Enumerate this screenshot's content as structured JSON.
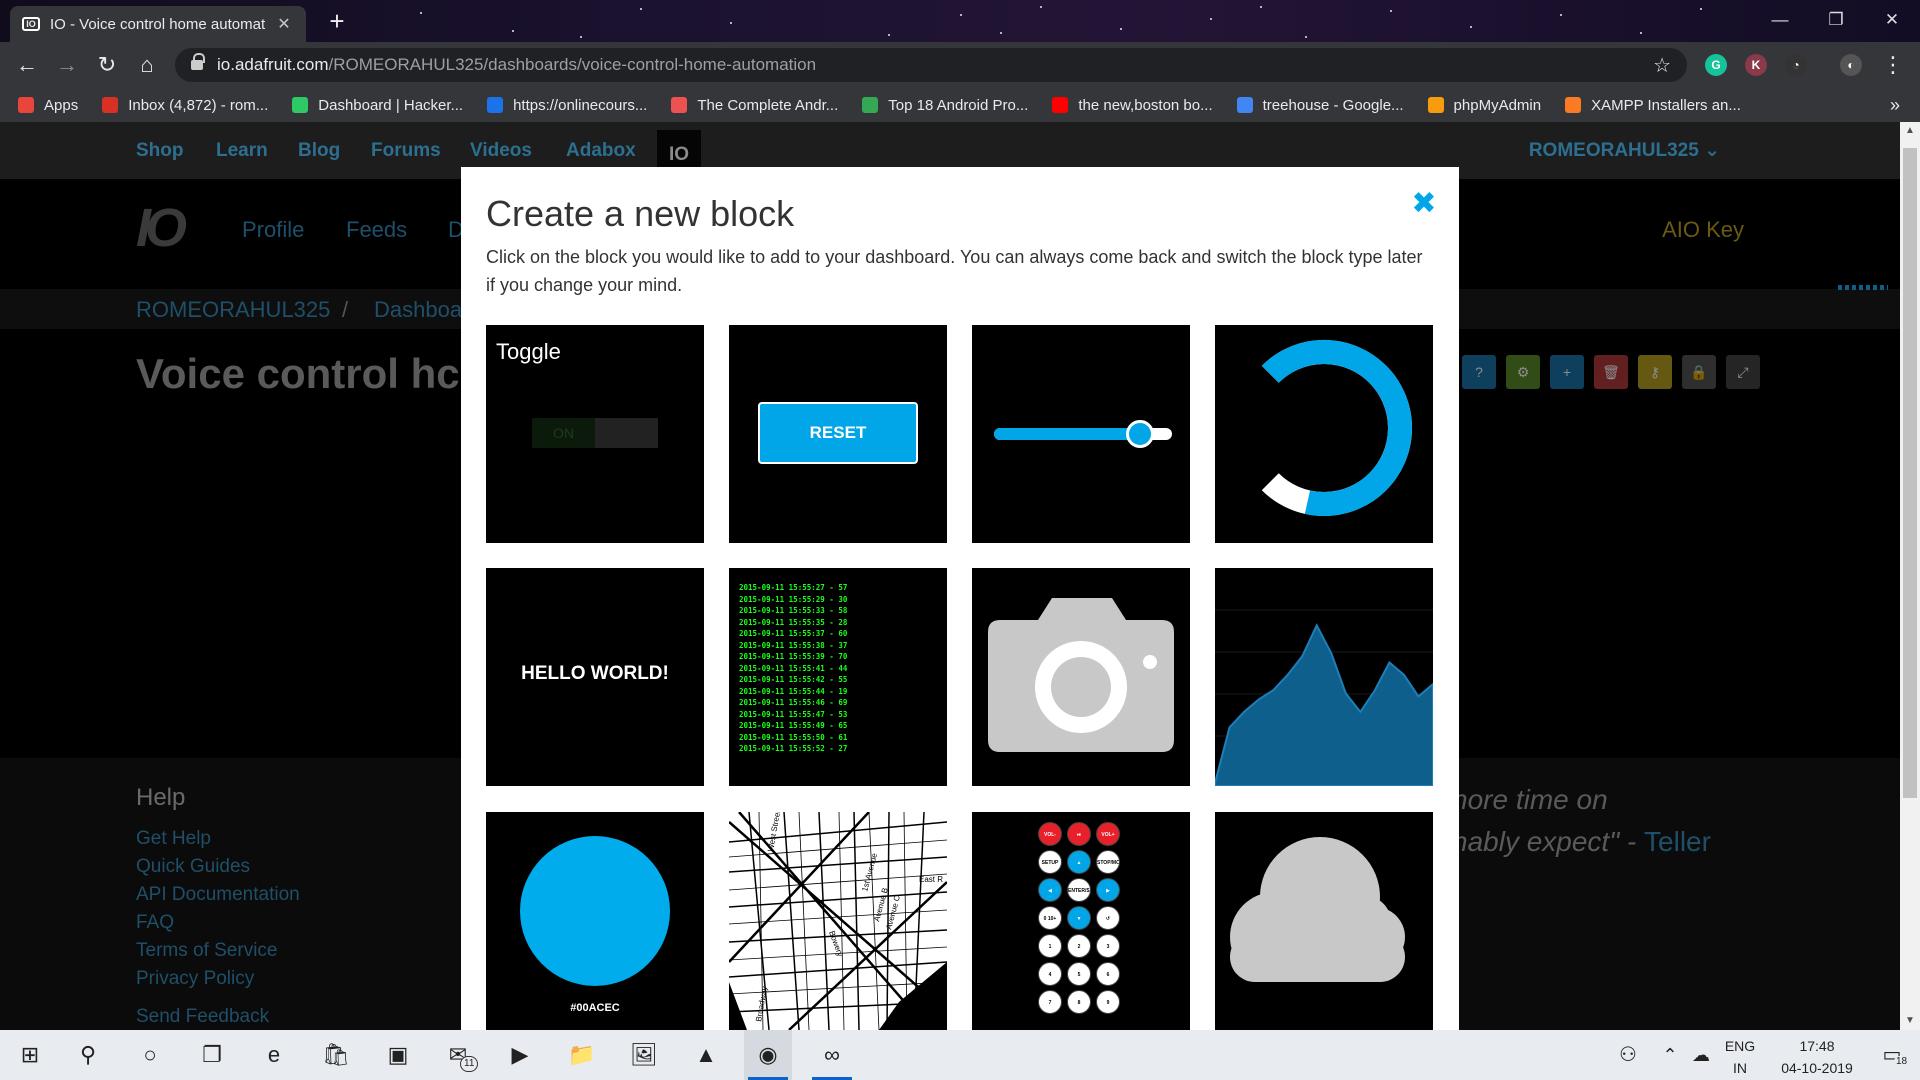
{
  "browser": {
    "tab_title": "IO - Voice control home automat",
    "tab_favicon": "IO",
    "new_tab_glyph": "+",
    "url_host": "io.adafruit.com",
    "url_path": "/ROMEORAHUL325/dashboards/voice-control-home-automation",
    "extensions": [
      {
        "icon": "grammarly-icon",
        "letter": "G",
        "color": "#15c39a"
      },
      {
        "icon": "k-extension-icon",
        "letter": "K",
        "color": "#8b3a4a"
      },
      {
        "icon": "speedometer-icon",
        "letter": "◔",
        "color": "#333333"
      },
      {
        "icon": "profile-avatar-icon",
        "letter": "◐",
        "color": "#555555"
      }
    ],
    "bookmarks": [
      {
        "label": "Apps",
        "icon": "apps-grid-icon",
        "color": "#e8453c"
      },
      {
        "label": "Inbox (4,872) - rom...",
        "icon": "gmail-icon",
        "color": "#d93025"
      },
      {
        "label": "Dashboard | Hacker...",
        "icon": "hackerrank-icon",
        "color": "#2ec866"
      },
      {
        "label": "https://onlinecours...",
        "icon": "s-icon",
        "color": "#1a73e8"
      },
      {
        "label": "The Complete Andr...",
        "icon": "udemy-icon",
        "color": "#ec5252"
      },
      {
        "label": "Top 18 Android Pro...",
        "icon": "doc-icon",
        "color": "#34a853"
      },
      {
        "label": "the new,boston bo...",
        "icon": "youtube-icon",
        "color": "#ff0000"
      },
      {
        "label": "treehouse - Google...",
        "icon": "google-icon",
        "color": "#4285f4"
      },
      {
        "label": "phpMyAdmin",
        "icon": "phpmyadmin-icon",
        "color": "#f89c0e"
      },
      {
        "label": "XAMPP Installers an...",
        "icon": "xampp-icon",
        "color": "#fb7a24"
      }
    ],
    "more_glyph": "»"
  },
  "page": {
    "nav": [
      "Shop",
      "Learn",
      "Blog",
      "Forums",
      "Videos",
      "Adabox"
    ],
    "nav_io": "IO",
    "user_menu": "ROMEORAHUL325",
    "sub_nav": [
      "Profile",
      "Feeds",
      "D"
    ],
    "aio_key": "AIO Key",
    "breadcrumb": [
      "ROMEORAHUL325",
      "Dashboa"
    ],
    "breadcrumb_sep": "/",
    "title": "Voice control hc",
    "footer": {
      "help_heading": "Help",
      "links": [
        "Get Help",
        "Quick Guides",
        "API Documentation",
        "FAQ",
        "Terms of Service",
        "Privacy Policy",
        "Send Feedback"
      ],
      "quote_line1": "nore time on",
      "quote_line2": "nably expect\" - ",
      "quote_author": "Teller"
    },
    "toolbar_buttons": [
      {
        "icon": "help-icon",
        "glyph": "?",
        "color": "#1a73a8"
      },
      {
        "icon": "settings-icon",
        "glyph": "⚙",
        "color": "#5a8a2a"
      },
      {
        "icon": "add-icon",
        "glyph": "+",
        "color": "#1a73a8"
      },
      {
        "icon": "delete-icon",
        "glyph": "🗑",
        "color": "#b33a3a"
      },
      {
        "icon": "key-icon",
        "glyph": "⚷",
        "color": "#b8a020"
      },
      {
        "icon": "lock-icon",
        "glyph": "🔒",
        "color": "#555555"
      },
      {
        "icon": "fullscreen-icon",
        "glyph": "⤢",
        "color": "#444444"
      }
    ]
  },
  "modal": {
    "title": "Create a new block",
    "close_glyph": "✖",
    "description": "Click on the block you would like to add to your dashboard. You can always come back and switch the block type later if you change your mind.",
    "blocks": {
      "toggle": {
        "label": "Toggle",
        "state": "ON"
      },
      "momentary": {
        "label": "RESET"
      },
      "slider": {
        "value": 0.82
      },
      "gauge": {
        "value": 0.88
      },
      "text": {
        "label": "HELLO WORLD!"
      },
      "stream": {
        "lines": [
          "2015-09-11 15:55:27 - 57",
          "2015-09-11 15:55:29 - 30",
          "2015-09-11 15:55:33 - 58",
          "2015-09-11 15:55:35 - 28",
          "2015-09-11 15:55:37 - 60",
          "2015-09-11 15:55:38 - 37",
          "2015-09-11 15:55:39 - 70",
          "2015-09-11 15:55:41 - 44",
          "2015-09-11 15:55:42 - 55",
          "2015-09-11 15:55:44 - 19",
          "2015-09-11 15:55:46 - 69",
          "2015-09-11 15:55:47 - 53",
          "2015-09-11 15:55:49 - 65",
          "2015-09-11 15:55:50 - 61",
          "2015-09-11 15:55:52 - 27"
        ]
      },
      "image": {
        "icon": "camera-icon"
      },
      "chart": {
        "values": [
          2,
          38,
          48,
          56,
          62,
          72,
          84,
          104,
          86,
          60,
          48,
          62,
          80,
          72,
          58,
          66
        ]
      },
      "color": {
        "hex": "#00ACEC"
      },
      "map": {
        "streets": [
          "West Street",
          "1st Avenue",
          "Avenue B",
          "Avenue C",
          "Bowery",
          "East R",
          "Broadway"
        ]
      },
      "remote": {
        "labels": [
          "VOL-",
          "⏯",
          "VOL+",
          "SETUP",
          "▲",
          "STOP/MODE",
          "◀",
          "ENTER/SAVE",
          "▶",
          "0 10+",
          "▼",
          "↺",
          "1",
          "2",
          "3",
          "4",
          "5",
          "6",
          "7",
          "8",
          "9"
        ]
      },
      "weather": {
        "icon": "cloud-icon"
      }
    }
  },
  "taskbar": {
    "apps": [
      {
        "icon": "windows-start-icon",
        "glyph": "⊞"
      },
      {
        "icon": "search-icon",
        "glyph": "⚲"
      },
      {
        "icon": "cortana-icon",
        "glyph": "○"
      },
      {
        "icon": "task-view-icon",
        "glyph": "❐"
      },
      {
        "icon": "edge-icon",
        "glyph": "e"
      },
      {
        "icon": "store-icon",
        "glyph": "🛍"
      },
      {
        "icon": "remote-desktop-icon",
        "glyph": "▣"
      },
      {
        "icon": "mail-icon",
        "glyph": "✉",
        "badge": "11"
      },
      {
        "icon": "media-player-icon",
        "glyph": "▶"
      },
      {
        "icon": "file-explorer-icon",
        "glyph": "📁"
      },
      {
        "icon": "photos-icon",
        "glyph": "🖼"
      },
      {
        "icon": "vlc-icon",
        "glyph": "▲"
      },
      {
        "icon": "chrome-icon",
        "glyph": "◉"
      },
      {
        "icon": "arduino-icon",
        "glyph": "∞"
      }
    ],
    "lang_line1": "ENG",
    "lang_line2": "IN",
    "time": "17:48",
    "date": "04-10-2019",
    "notifications": "18"
  }
}
